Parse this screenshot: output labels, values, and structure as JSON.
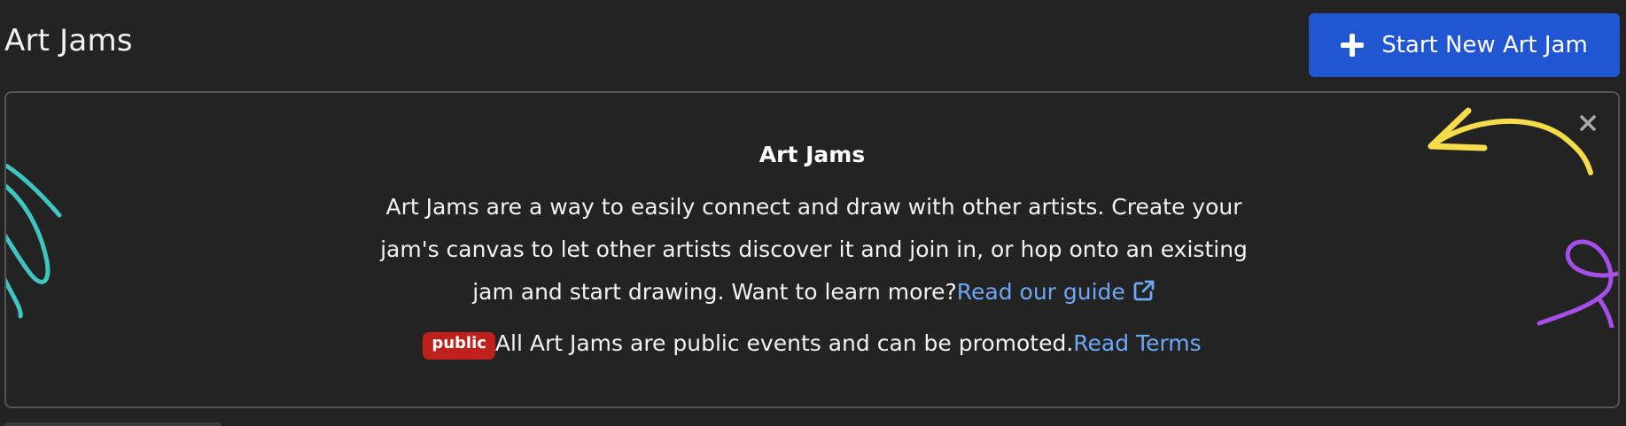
{
  "header": {
    "title": "Art Jams",
    "start_button_label": "Start New Art Jam",
    "start_button_color": "#2056d1"
  },
  "banner": {
    "heading": "Art Jams",
    "body_text": "Art Jams are a way to easily connect and draw with other artists. Create your jam's canvas to let other artists discover it and join in, or hop onto an existing jam and start drawing. Want to learn more?",
    "guide_link_label": "Read our guide",
    "public_badge": "public",
    "public_text": "All Art Jams are public events and can be promoted.",
    "terms_link_label": "Read Terms",
    "link_color": "#6ea8f5",
    "badge_color": "#c0201b",
    "icons": [
      "external-link-icon",
      "close-icon",
      "plus-icon"
    ]
  }
}
